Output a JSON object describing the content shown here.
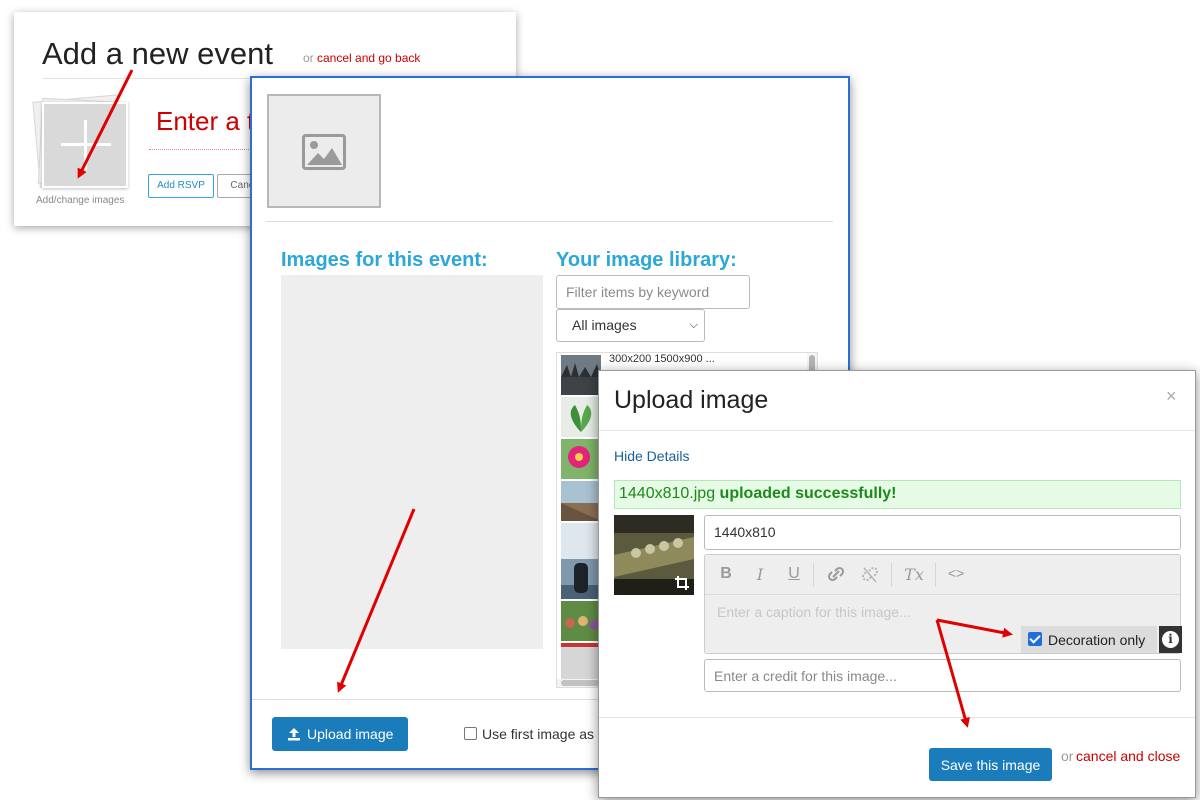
{
  "event_page": {
    "title": "Add a new event",
    "or_text": "or",
    "cancel_link": "cancel and go back",
    "add_change_label": "Add/change images",
    "event_name_placeholder": "Enter a t",
    "add_rsvp_label": "Add RSVP",
    "cancel_label": "Cancel"
  },
  "library_dialog": {
    "event_images_heading": "Images for this event:",
    "library_heading": "Your image library:",
    "filter_placeholder": "Filter items by keyword",
    "select_value": "All images",
    "list_first_meta": "300x200     1500x900 ...",
    "upload_button_label": "Upload image",
    "first_image_label": "Use first image as"
  },
  "upload_modal": {
    "title": "Upload image",
    "close_glyph": "×",
    "hide_details": "Hide Details",
    "success_filename": "1440x810.jpg",
    "success_message": "uploaded successfully!",
    "alt_text_value": "1440x810",
    "toolbar": {
      "bold": "B",
      "italic": "I",
      "underline": "U",
      "link_icon": "link-icon",
      "unlink_icon": "unlink-icon",
      "clear_format": "Tx",
      "code": "<>"
    },
    "caption_placeholder": "Enter a caption for this image...",
    "decoration_label": "Decoration only",
    "decoration_checked": true,
    "info_glyph": "i",
    "credit_placeholder": "Enter a credit for this image...",
    "save_label": "Save this image",
    "footer_or": "or",
    "cancel_close_label": "cancel and close"
  },
  "colors": {
    "accent_blue": "#1a7cba",
    "heading_cyan": "#2ca8d8",
    "link_red": "#cc0000",
    "success_green": "#1b8a1b",
    "arrow_red": "#e00000"
  }
}
